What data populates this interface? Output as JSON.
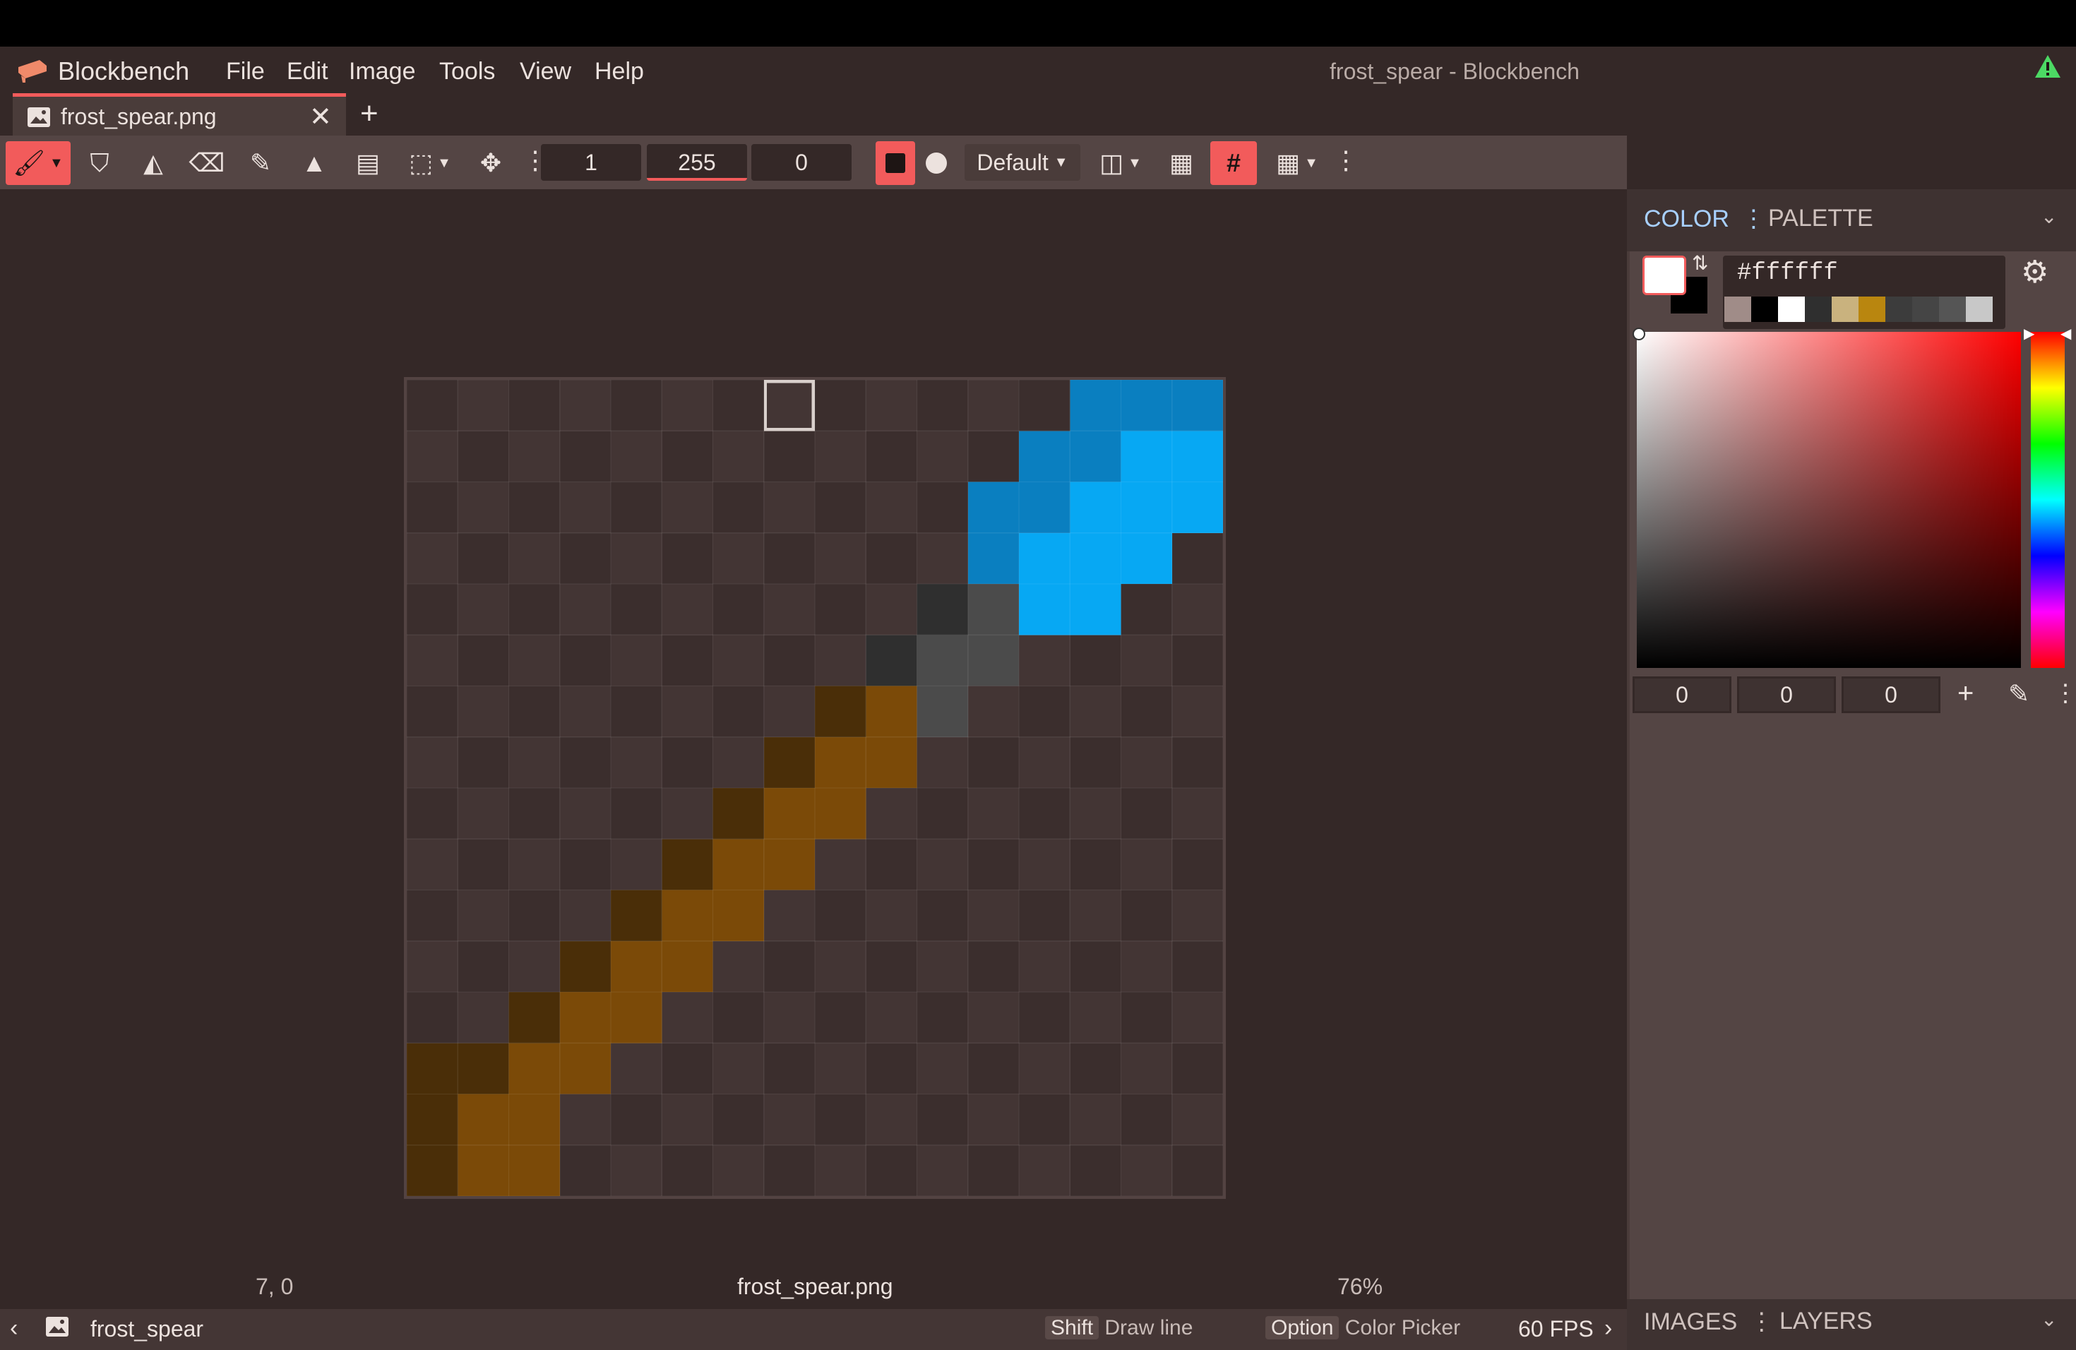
{
  "app": {
    "name": "Blockbench",
    "window_title": "frost_spear - Blockbench",
    "menu": [
      "File",
      "Edit",
      "Image",
      "Tools",
      "View",
      "Help"
    ]
  },
  "tabs": [
    {
      "label": "frost_spear.png",
      "active": true
    }
  ],
  "toolbar": {
    "size": "1",
    "opacity": "255",
    "softness": "0",
    "brush_mode": "Default"
  },
  "status": {
    "cursor": "7, 0",
    "filename": "frost_spear.png",
    "zoom": "76%"
  },
  "bottombar": {
    "texture_name": "frost_spear",
    "shift_key": "Shift",
    "shift_action": "Draw line",
    "option_key": "Option",
    "option_action": "Color Picker",
    "fps": "60 FPS"
  },
  "color_panel": {
    "tab_color": "COLOR",
    "tab_palette": "PALETTE",
    "hex": "#ffffff",
    "r": "0",
    "g": "0",
    "b": "0",
    "primary": "#ffffff",
    "secondary": "#000000",
    "history": [
      "#a08c88",
      "#000000",
      "#ffffff",
      "#2f2f2f",
      "#c9b27e",
      "#b9860f",
      "#3c3c3c",
      "#454545",
      "#555555",
      "#c8c8c8"
    ]
  },
  "bottom_panel": {
    "tab_images": "IMAGES",
    "tab_layers": "LAYERS"
  },
  "texture": {
    "size": 16,
    "palette": {
      "A": "#0a7fc0",
      "B": "#07a8f3",
      "C": "#2f2f2f",
      "D": "#4b4b4b",
      "E": "#4a2e08",
      "F": "#7b4a08"
    },
    "rows": [
      "             AAA",
      "            AABB",
      "           AABBB",
      "           ABBB ",
      "          CDBB  ",
      "         CDD    ",
      "        EFD     ",
      "       EFF      ",
      "      EFF       ",
      "     EFF        ",
      "    EFF         ",
      "   EFF          ",
      "  EFF           ",
      "EEFF            ",
      "EFF             ",
      "EFF             "
    ],
    "selected_cell": [
      7,
      0
    ]
  }
}
